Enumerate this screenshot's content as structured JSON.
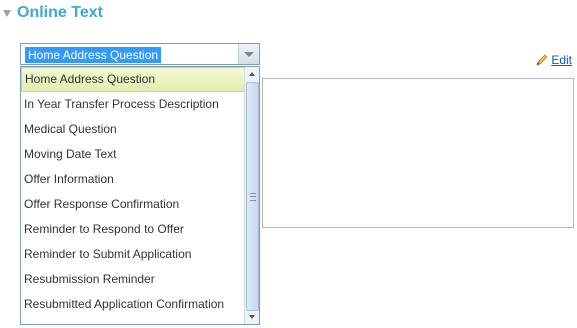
{
  "section": {
    "title": "Online Text",
    "toggle_icon": "collapse-triangle-icon"
  },
  "edit": {
    "label": "Edit",
    "icon": "pencil-icon"
  },
  "select": {
    "value": "Home Address Question",
    "options": [
      "Home Address Question",
      "In Year Transfer Process Description",
      "Medical Question",
      "Moving Date Text",
      "Offer Information",
      "Offer Response Confirmation",
      "Reminder to Respond to Offer",
      "Reminder to Submit Application",
      "Resubmission Reminder",
      "Resubmitted Application Confirmation"
    ]
  },
  "colors": {
    "title": "#3ea7d1",
    "link": "#0b5bb5",
    "selected_value_bg": "#3399ff",
    "highlighted_option_bg": "#e9f0bf"
  }
}
